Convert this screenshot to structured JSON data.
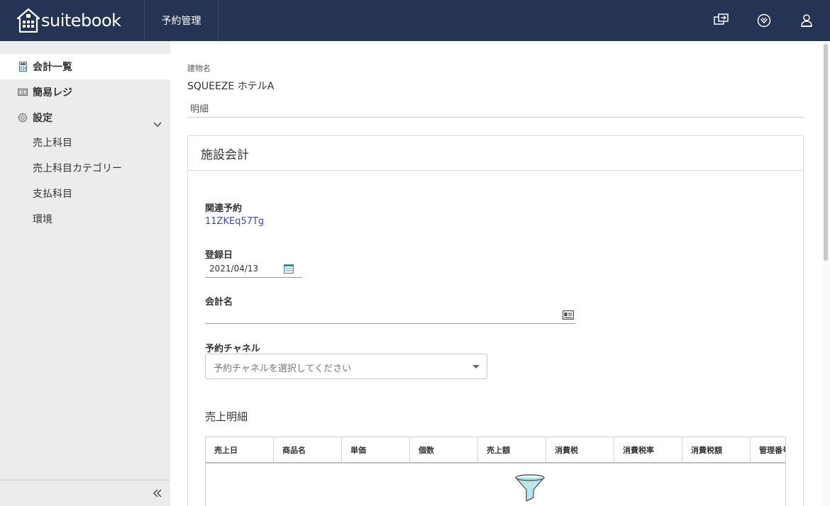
{
  "header": {
    "brand": "suitebook",
    "nav_label": "予約管理",
    "icons": [
      "transfer-icon",
      "checkmark-circle-icon",
      "user-icon"
    ]
  },
  "sidebar": {
    "items": [
      {
        "label": "会計一覧",
        "icon": "calculator-icon",
        "active": true
      },
      {
        "label": "簡易レジ",
        "icon": "cash-icon",
        "active": false
      },
      {
        "label": "設定",
        "icon": "gear-icon",
        "active": false
      }
    ],
    "sub_items": [
      "売上科目",
      "売上科目カテゴリー",
      "支払科目",
      "環境"
    ]
  },
  "main": {
    "building_label": "建物名",
    "building_value": "SQUEEZE ホテルA",
    "tab_label": "明細",
    "card_title": "施設会計",
    "related_reservation_label": "関連予約",
    "related_reservation_value": "11ZKEq57Tg",
    "registration_date_label": "登録日",
    "registration_date_value": "2021/04/13",
    "account_name_label": "会計名",
    "account_name_value": "",
    "channel_label": "予約チャネル",
    "channel_placeholder": "予約チャネルを選択してください",
    "sales_section_title": "売上明細",
    "table_headers": [
      "売上日",
      "商品名",
      "単価",
      "個数",
      "売上額",
      "消費税",
      "消費税率",
      "消費税額",
      "管理番号"
    ],
    "table_rows": []
  },
  "colors": {
    "header_bg": "#253454",
    "sidebar_bg": "#ececec",
    "link": "#3a4ea8",
    "funnel_accent": "#7fd3dc"
  }
}
